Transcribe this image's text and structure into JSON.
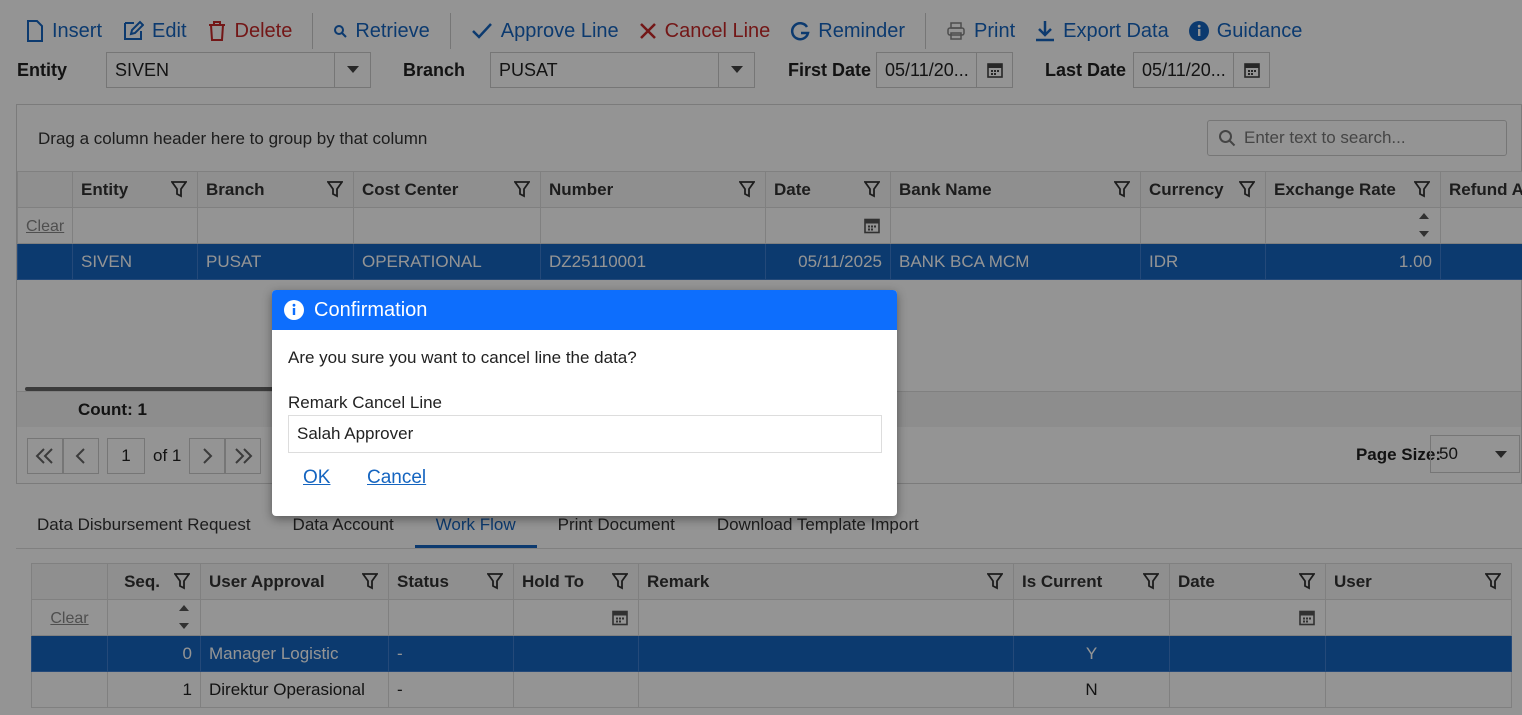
{
  "toolbar": {
    "insert": "Insert",
    "edit": "Edit",
    "delete": "Delete",
    "retrieve": "Retrieve",
    "approve_line": "Approve Line",
    "cancel_line": "Cancel Line",
    "reminder": "Reminder",
    "print": "Print",
    "export_data": "Export Data",
    "guidance": "Guidance"
  },
  "filters": {
    "entity_label": "Entity",
    "entity_value": "SIVEN",
    "branch_label": "Branch",
    "branch_value": "PUSAT",
    "first_date_label": "First Date",
    "first_date_value": "05/11/20...",
    "last_date_label": "Last Date",
    "last_date_value": "05/11/20..."
  },
  "main_grid": {
    "group_hint": "Drag a column header here to group by that column",
    "search_placeholder": "Enter text to search...",
    "columns": [
      "Entity",
      "Branch",
      "Cost Center",
      "Number",
      "Date",
      "Bank Name",
      "Currency",
      "Exchange Rate",
      "Refund A"
    ],
    "clear": "Clear",
    "row": [
      "SIVEN",
      "PUSAT",
      "OPERATIONAL",
      "DZ25110001",
      "05/11/2025",
      "BANK BCA MCM",
      "IDR",
      "1.00",
      ""
    ],
    "count": "Count: 1"
  },
  "pager": {
    "page": "1",
    "of": "of 1",
    "page_size_label": "Page Size:",
    "page_size": "50"
  },
  "tabs": [
    "Data Disbursement Request",
    "Data Account",
    "Work Flow",
    "Print Document",
    "Download Template Import"
  ],
  "workflow_grid": {
    "columns": [
      "Seq.",
      "User Approval",
      "Status",
      "Hold To",
      "Remark",
      "Is Current",
      "Date",
      "User"
    ],
    "clear": "Clear",
    "rows": [
      [
        "0",
        "Manager Logistic",
        "-",
        "",
        "",
        "Y",
        "",
        ""
      ],
      [
        "1",
        "Direktur Operasional",
        "-",
        "",
        "",
        "N",
        "",
        ""
      ]
    ]
  },
  "dialog": {
    "title": "Confirmation",
    "message": "Are you sure you want to cancel line the data?",
    "remark_label": "Remark Cancel Line",
    "remark_value": "Salah Approver",
    "ok": "OK",
    "cancel": "Cancel"
  },
  "colors": {
    "accent": "#1565c0",
    "danger": "#c62828",
    "dialog_header": "#0d6efd"
  }
}
